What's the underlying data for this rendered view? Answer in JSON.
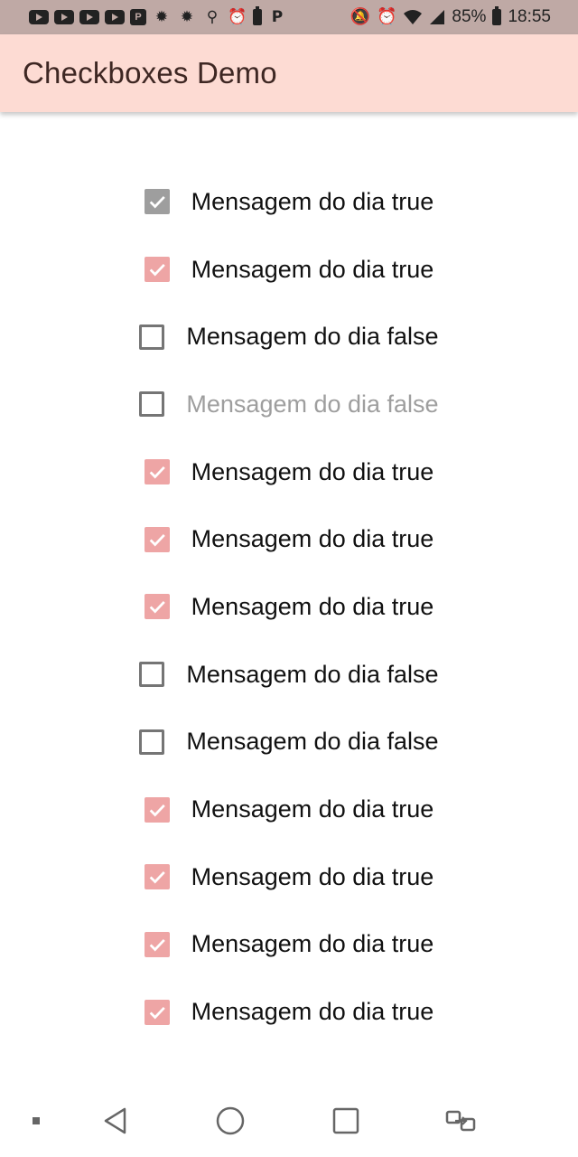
{
  "status_bar": {
    "battery": "85%",
    "time": "18:55",
    "notification_icons": [
      "youtube-icon",
      "youtube-icon",
      "youtube-icon",
      "youtube-icon",
      "parking-icon",
      "bug-icon",
      "bug-icon",
      "usb-icon",
      "alarm-icon",
      "battery-saver-icon",
      "paypal-icon"
    ],
    "system_icons": [
      "mute-icon",
      "alarm-icon",
      "wifi-icon",
      "signal-icon"
    ]
  },
  "app_bar": {
    "title": "Checkboxes Demo",
    "color": "#fddbd3"
  },
  "checkboxes": [
    {
      "label": "Mensagem do dia true",
      "checked": true,
      "style": "grey"
    },
    {
      "label": "Mensagem do dia true",
      "checked": true,
      "style": "pink"
    },
    {
      "label": "Mensagem do dia false",
      "checked": false,
      "style": "normal"
    },
    {
      "label": "Mensagem do dia false",
      "checked": false,
      "style": "disabled"
    },
    {
      "label": "Mensagem do dia true",
      "checked": true,
      "style": "pink"
    },
    {
      "label": "Mensagem do dia true",
      "checked": true,
      "style": "pink"
    },
    {
      "label": "Mensagem do dia true",
      "checked": true,
      "style": "pink"
    },
    {
      "label": "Mensagem do dia false",
      "checked": false,
      "style": "normal"
    },
    {
      "label": "Mensagem do dia false",
      "checked": false,
      "style": "normal"
    },
    {
      "label": "Mensagem do dia true",
      "checked": true,
      "style": "pink"
    },
    {
      "label": "Mensagem do dia true",
      "checked": true,
      "style": "pink"
    },
    {
      "label": "Mensagem do dia true",
      "checked": true,
      "style": "pink"
    },
    {
      "label": "Mensagem do dia true",
      "checked": true,
      "style": "pink"
    }
  ],
  "colors": {
    "checked": "#eea5a5",
    "checked_grey": "#9e9e9e",
    "disabled_text": "#9e9e9e"
  },
  "nav_bar": [
    "menu-dot-icon",
    "back-icon",
    "home-icon",
    "recents-icon",
    "switch-app-icon"
  ]
}
